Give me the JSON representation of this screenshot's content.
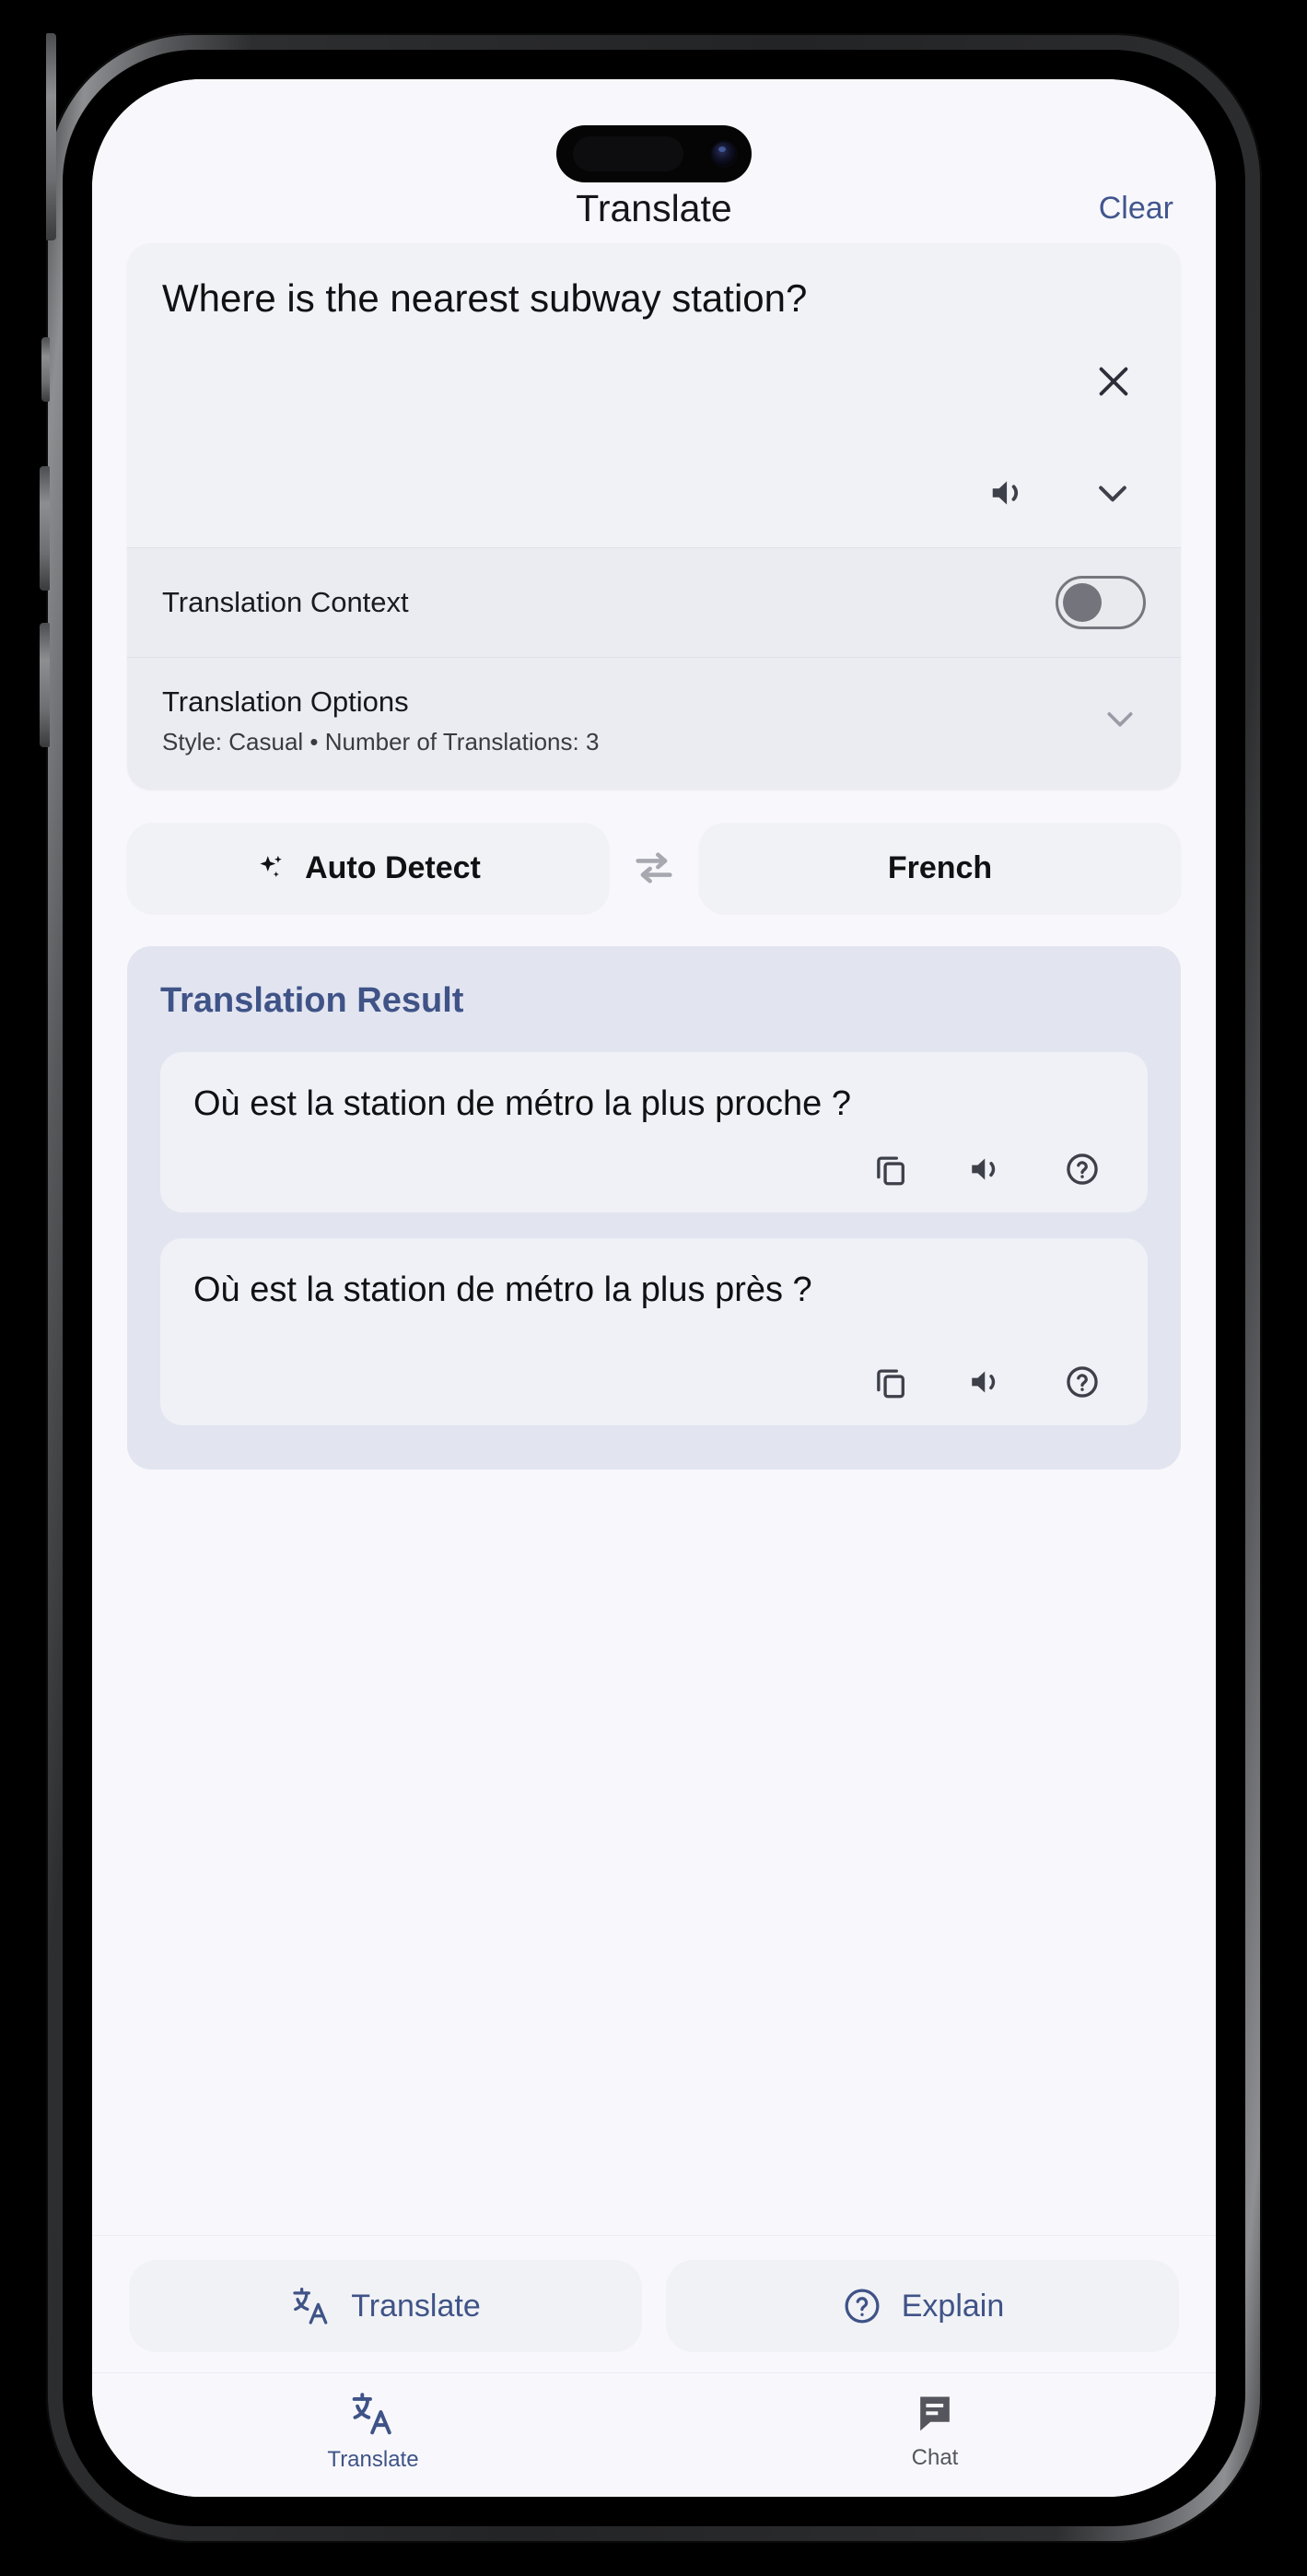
{
  "header": {
    "title": "Translate",
    "clear_label": "Clear"
  },
  "input_card": {
    "text": "Where is the nearest subway station?",
    "clear_icon": "close-icon",
    "speak_icon": "speaker-icon",
    "expand_icon": "chevron-down-icon"
  },
  "context_row": {
    "label": "Translation Context",
    "toggle_state": "off"
  },
  "options_row": {
    "title": "Translation Options",
    "subtitle": "Style: Casual • Number of Translations: 3",
    "expand_icon": "chevron-down-icon"
  },
  "languages": {
    "source": "Auto Detect",
    "source_icon": "sparkle-icon",
    "swap_icon": "swap-arrows-icon",
    "target": "French"
  },
  "result": {
    "heading": "Translation Result",
    "cards": [
      {
        "text": "Où est la station de métro la plus proche ?",
        "actions": [
          "copy-icon",
          "speaker-icon",
          "help-circle-icon"
        ]
      },
      {
        "text": "Où est la station de métro la plus près ?",
        "actions": [
          "copy-icon",
          "speaker-icon",
          "help-circle-icon"
        ]
      }
    ]
  },
  "bottom_actions": [
    {
      "label": "Translate",
      "icon": "translate-icon"
    },
    {
      "label": "Explain",
      "icon": "help-circle-icon"
    }
  ],
  "tabs": [
    {
      "label": "Translate",
      "icon": "translate-icon",
      "active": true
    },
    {
      "label": "Chat",
      "icon": "chat-bubble-icon",
      "active": false
    }
  ],
  "colors": {
    "accent_blue": "#3f5387",
    "link_blue": "#42568e",
    "screen_bg": "#f8f8fc",
    "card_bg": "#f1f2f6",
    "result_panel_bg": "#e2e5f0",
    "icon_dark": "#3d3f49",
    "inactive_gray": "#55565d"
  }
}
